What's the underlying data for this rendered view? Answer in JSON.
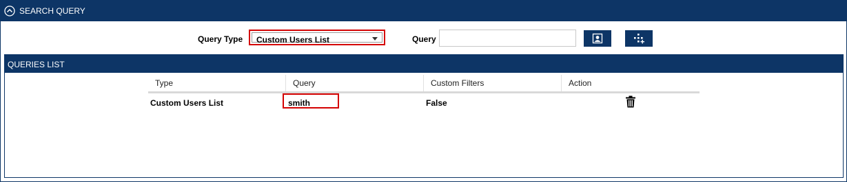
{
  "search_panel": {
    "title": "SEARCH QUERY",
    "query_type_label": "Query Type",
    "query_type_value": "Custom Users List",
    "query_label": "Query",
    "query_value": "",
    "query_placeholder": "",
    "buttons": {
      "search_icon": "user-search-icon",
      "add_icon": "add-nodes-icon"
    }
  },
  "queries_list": {
    "title": "QUERIES LIST",
    "columns": [
      "Type",
      "Query",
      "Custom Filters",
      "Action"
    ],
    "rows": [
      {
        "type": "Custom Users List",
        "query": "smith",
        "custom_filters": "False",
        "action_icon": "trash-icon"
      }
    ]
  },
  "colors": {
    "header_bg": "#0d3566",
    "highlight": "#d40000"
  }
}
